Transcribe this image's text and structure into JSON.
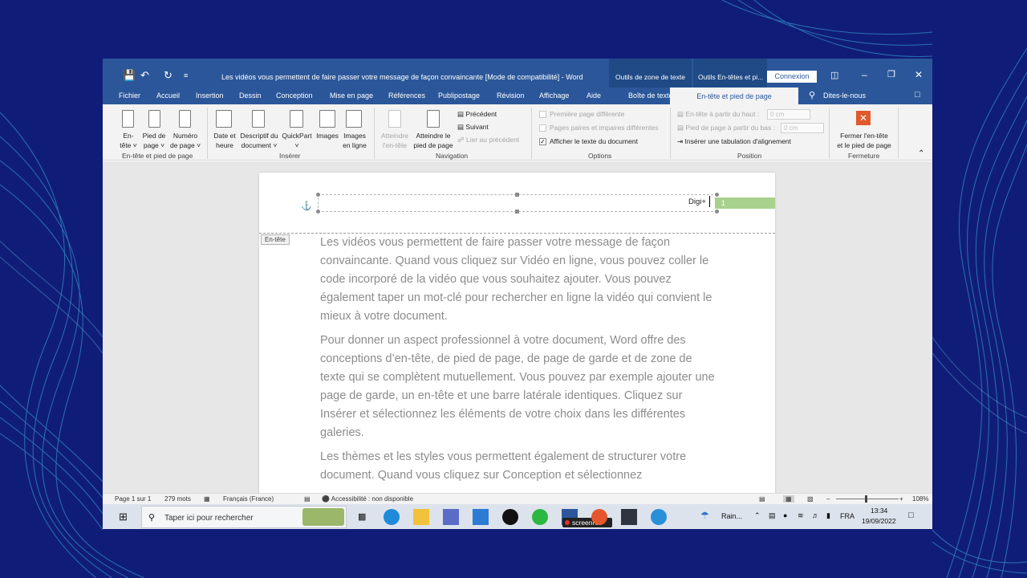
{
  "window": {
    "title": "Les vidéos vous permettent de faire passer votre message de façon convaincante [Mode de compatibilité]  -  Word",
    "context_group_1": "Outils de zone de texte",
    "context_group_2": "Outils En-têtes et pi...",
    "signin": "Connexion"
  },
  "tabs": [
    "Fichier",
    "Accueil",
    "Insertion",
    "Dessin",
    "Conception",
    "Mise en page",
    "Références",
    "Publipostage",
    "Révision",
    "Affichage",
    "Aide"
  ],
  "context_tabs": {
    "textbox": "Boîte de texte",
    "header_footer": "En-tête et pied de page"
  },
  "tellme": "Dites-le-nous",
  "ribbon": {
    "header_l1": "En-",
    "header_l2": "tête",
    "footer_l1": "Pied de",
    "footer_l2": "page",
    "pagenum_l1": "Numéro",
    "pagenum_l2": "de page",
    "group_hf": "En-tête et pied de page",
    "date_l1": "Date et",
    "date_l2": "heure",
    "docinfo_l1": "Descriptif du",
    "docinfo_l2": "document",
    "quickpart": "QuickPart",
    "images": "Images",
    "online_l1": "Images",
    "online_l2": "en ligne",
    "group_insert": "Insérer",
    "gotohead_l1": "Atteindre",
    "gotohead_l2": "l'en-tête",
    "gotofoot_l1": "Atteindre le",
    "gotofoot_l2": "pied de page",
    "previous": "Précédent",
    "next": "Suivant",
    "link_prev": "Lier au précédent",
    "group_nav": "Navigation",
    "opt_first": "Première page différente",
    "opt_oddeven": "Pages paires et impaires différentes",
    "opt_showtext": "Afficher le texte du document",
    "group_options": "Options",
    "pos_header": "En-tête à partir du haut :",
    "pos_header_val": "0 cm",
    "pos_footer": "Pied de page à partir du bas :",
    "pos_footer_val": "0 cm",
    "pos_tab": "Insérer une tabulation d'alignement",
    "group_position": "Position",
    "close_l1": "Fermer l'en-tête",
    "close_l2": "et le pied de page",
    "group_close": "Fermeture"
  },
  "document": {
    "header_text": "Digi+",
    "header_num": "1",
    "header_tag": "En-tête",
    "p1": "Les vidéos vous permettent de faire passer votre message de façon convaincante. Quand vous cliquez sur Vidéo en ligne, vous pouvez coller le code incorporé de la vidéo que vous souhaitez ajouter. Vous pouvez également taper un mot-clé pour rechercher en ligne la vidéo qui convient le mieux à votre document.",
    "p2": "Pour donner un aspect professionnel à votre document, Word offre des conceptions d’en-tête, de pied de page, de page de garde et de zone de texte qui se complètent mutuellement. Vous pouvez par exemple ajouter une page de garde, un en-tête et une barre latérale identiques. Cliquez sur Insérer et sélectionnez les éléments de votre choix dans les différentes galeries.",
    "p3": "Les thèmes et les styles vous permettent également de structurer votre document. Quand vous cliquez sur Conception et sélectionnez"
  },
  "status": {
    "page": "Page 1 sur 1",
    "words": "279 mots",
    "language": "Français (France)",
    "accessibility": "Accessibilité : non disponible",
    "zoom": "108%"
  },
  "taskbar": {
    "search_placeholder": "Taper ici pour rechercher",
    "weather": "Rain...",
    "lang": "FRA",
    "time": "13:34",
    "date": "19/09/2022",
    "screenrec": "screenrec"
  },
  "colors": {
    "word_blue": "#2b579a",
    "accent_green": "#a9d18e",
    "close_red": "#e05a2b"
  }
}
